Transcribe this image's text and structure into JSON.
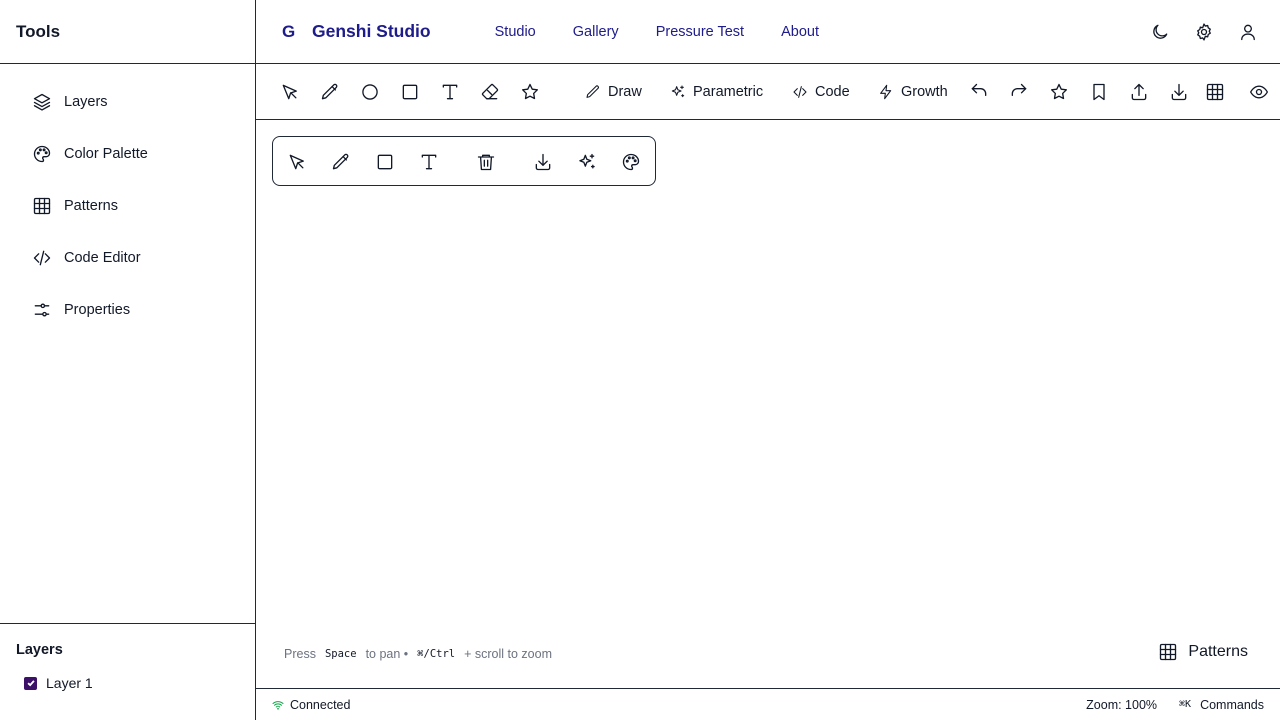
{
  "sidebar": {
    "title": "Tools",
    "items": [
      {
        "label": "Layers",
        "icon": "layers-icon"
      },
      {
        "label": "Color Palette",
        "icon": "palette-icon"
      },
      {
        "label": "Patterns",
        "icon": "grid-icon"
      },
      {
        "label": "Code Editor",
        "icon": "code-icon"
      },
      {
        "label": "Properties",
        "icon": "sliders-icon"
      }
    ],
    "layers_panel": {
      "title": "Layers",
      "layers": [
        {
          "label": "Layer 1",
          "checked": true
        }
      ]
    }
  },
  "header": {
    "logo": "G",
    "brand": "Genshi Studio",
    "nav": [
      "Studio",
      "Gallery",
      "Pressure Test",
      "About"
    ],
    "actions": [
      "moon-icon",
      "gear-icon",
      "user-icon"
    ]
  },
  "toolbar": {
    "tools": [
      "select-icon",
      "pencil-icon",
      "circle-icon",
      "square-icon",
      "text-icon",
      "eraser-icon",
      "star-icon"
    ],
    "modes": [
      {
        "label": "Draw",
        "icon": "pencil-icon"
      },
      {
        "label": "Parametric",
        "icon": "sparkles-icon"
      },
      {
        "label": "Code",
        "icon": "code-icon"
      },
      {
        "label": "Growth",
        "icon": "zap-icon"
      }
    ],
    "actions": [
      "undo-icon",
      "redo-icon",
      "star-icon",
      "bookmark-icon",
      "upload-icon",
      "download-icon",
      "grid-icon",
      "eye-icon"
    ]
  },
  "canvas": {
    "floating_tools": [
      "select-icon",
      "pencil-icon",
      "square-icon",
      "text-icon",
      "trash-icon",
      "download-icon",
      "sparkles-icon",
      "palette-icon"
    ],
    "hint": {
      "press": "Press",
      "key1": "Space",
      "to_pan": "to pan •",
      "key2": "⌘/Ctrl",
      "scroll": "+ scroll to zoom"
    },
    "patterns_button": "Patterns"
  },
  "status": {
    "connection": "Connected",
    "zoom": "Zoom: 100%",
    "commands_key": "⌘K",
    "commands": "Commands"
  },
  "colors": {
    "brand": "#1e1b8a",
    "border": "#1f2937",
    "checkbox": "#3b1066",
    "connected": "#16a34a"
  }
}
